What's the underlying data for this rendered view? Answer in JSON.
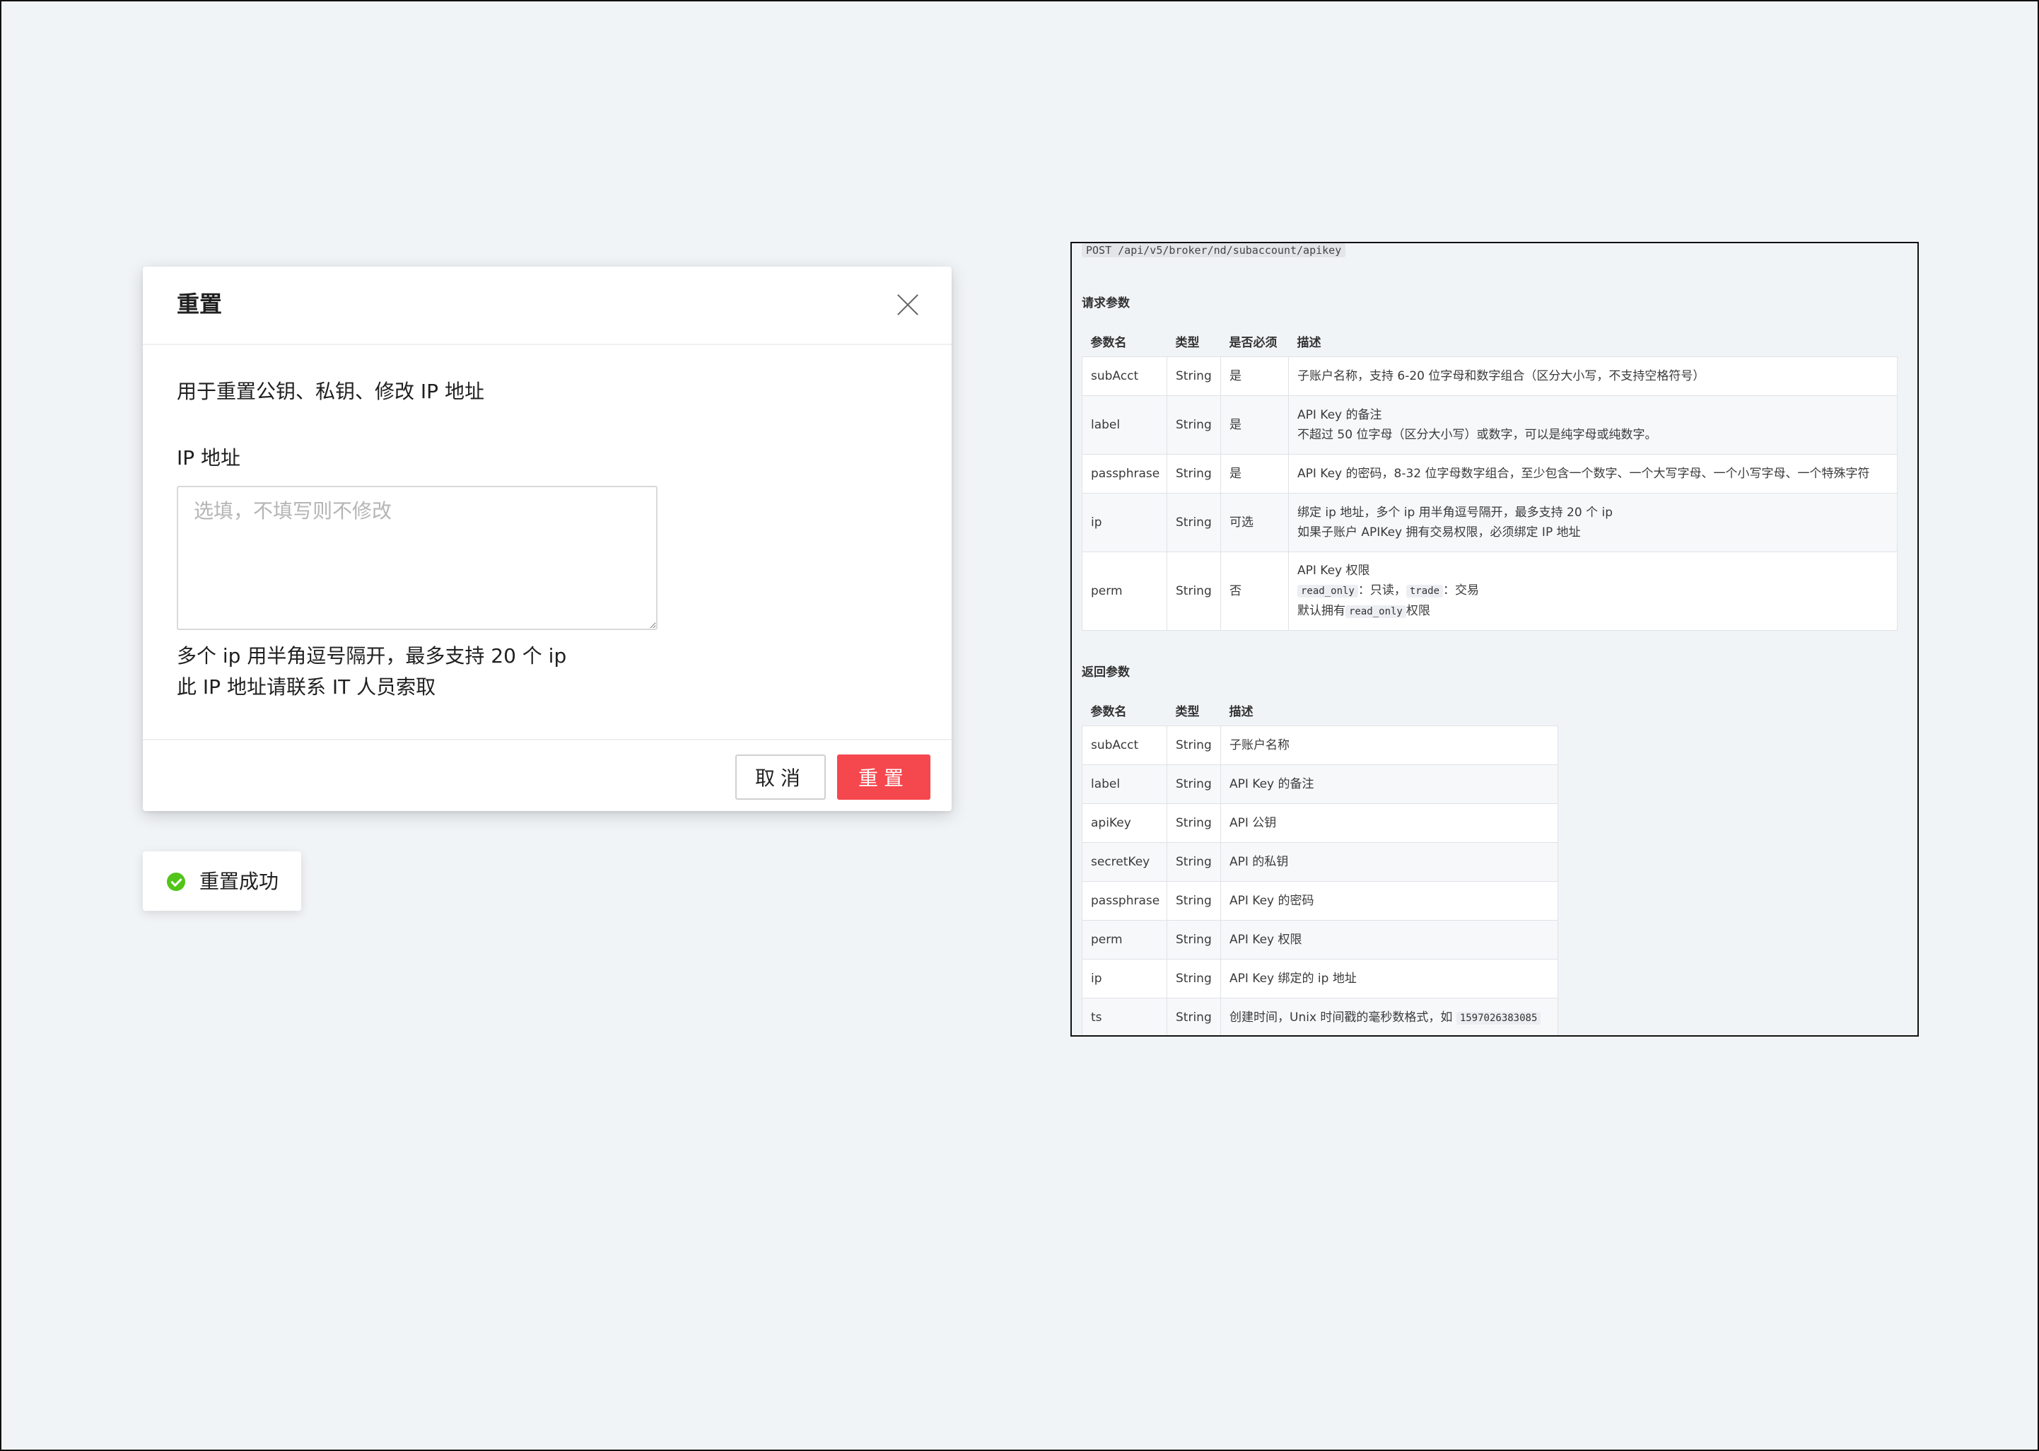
{
  "modal": {
    "title": "重置",
    "description": "用于重置公钥、私钥、修改 IP 地址",
    "ip_label": "IP 地址",
    "ip_placeholder": "选填，不填写则不修改",
    "ip_value": "",
    "hint_line1": "多个 ip 用半角逗号隔开，最多支持 20 个 ip",
    "hint_line2": "此 IP 地址请联系 IT 人员索取",
    "cancel_label": "取消",
    "confirm_label": "重置"
  },
  "toast": {
    "text": "重置成功",
    "icon": "check-circle-icon"
  },
  "doc": {
    "endpoint": "POST /api/v5/broker/nd/subaccount/apikey",
    "request_title": "请求参数",
    "request_headers": [
      "参数名",
      "类型",
      "是否必须",
      "描述"
    ],
    "request_rows": [
      {
        "name": "subAcct",
        "type": "String",
        "required": "是",
        "desc": [
          "子账户名称，支持 6-20 位字母和数字组合（区分大小写，不支持空格符号）"
        ]
      },
      {
        "name": "label",
        "type": "String",
        "required": "是",
        "desc": [
          "API Key 的备注",
          "不超过 50 位字母（区分大小写）或数字，可以是纯字母或纯数字。"
        ]
      },
      {
        "name": "passphrase",
        "type": "String",
        "required": "是",
        "desc": [
          "API Key 的密码，8-32 位字母数字组合，至少包含一个数字、一个大写字母、一个小写字母、一个特殊字符"
        ]
      },
      {
        "name": "ip",
        "type": "String",
        "required": "可选",
        "desc": [
          "绑定 ip 地址，多个 ip 用半角逗号隔开，最多支持 20 个 ip",
          "如果子账户 APIKey 拥有交易权限，必须绑定 IP 地址"
        ]
      },
      {
        "name": "perm",
        "type": "String",
        "required": "否",
        "desc_perm": {
          "line1": "API Key 权限",
          "code_read_only": "read_only",
          "text_read_only": "：只读，",
          "code_trade": "trade",
          "text_trade": "：交易",
          "default_prefix": "默认拥有",
          "default_code": "read_only",
          "default_suffix": "权限"
        }
      }
    ],
    "return_title": "返回参数",
    "return_headers": [
      "参数名",
      "类型",
      "描述"
    ],
    "return_rows": [
      {
        "name": "subAcct",
        "type": "String",
        "desc": "子账户名称"
      },
      {
        "name": "label",
        "type": "String",
        "desc": "API Key 的备注"
      },
      {
        "name": "apiKey",
        "type": "String",
        "desc": "API 公钥"
      },
      {
        "name": "secretKey",
        "type": "String",
        "desc": "API 的私钥"
      },
      {
        "name": "passphrase",
        "type": "String",
        "desc": "API Key 的密码"
      },
      {
        "name": "perm",
        "type": "String",
        "desc": "API Key 权限"
      },
      {
        "name": "ip",
        "type": "String",
        "desc": "API Key 绑定的 ip 地址"
      },
      {
        "name": "ts",
        "type": "String",
        "desc": "创建时间，Unix 时间戳的毫秒数格式，如",
        "code": "1597026383085"
      }
    ]
  }
}
